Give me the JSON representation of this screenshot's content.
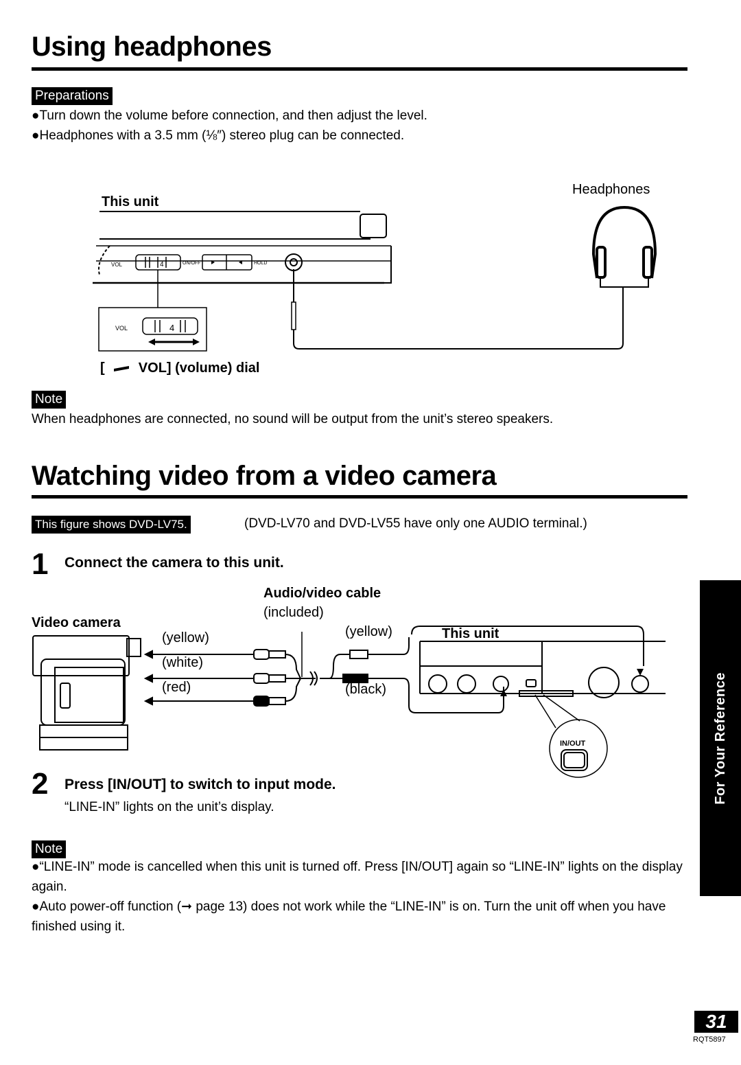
{
  "section1": {
    "title": "Using headphones",
    "preparations_label": "Preparations",
    "bullets": [
      "●Turn down the volume before connection, and then adjust the level.",
      "●Headphones with a 3.5 mm (⅛″) stereo plug can be connected."
    ],
    "figure": {
      "this_unit_label": "This unit",
      "headphones_label": "Headphones",
      "vol_label": "VOL",
      "dial_value": "4",
      "on_off_label": "ON/OFF",
      "hold_label": "HOLD",
      "dial_caption_prefix": "[",
      "dial_caption": "VOL] (volume) dial"
    },
    "note_label": "Note",
    "note_text": "When headphones are connected, no sound will be output from the unit’s stereo speakers."
  },
  "section2": {
    "title": "Watching video from a video camera",
    "figure_tag": "This figure shows DVD-LV75.",
    "figure_tag_note": "(DVD-LV70 and DVD-LV55 have only one AUDIO terminal.)",
    "steps": [
      {
        "number": "1",
        "title": "Connect the camera to this unit."
      },
      {
        "number": "2",
        "title": "Press [IN/OUT] to switch to input mode.",
        "detail": "“LINE-IN” lights on the unit’s display."
      }
    ],
    "figure": {
      "cable_label": "Audio/video cable",
      "cable_sub": "(included)",
      "camera_label": "Video camera",
      "plug_left": [
        "(yellow)",
        "(white)",
        "(red)"
      ],
      "plug_right": [
        "(yellow)",
        "(black)"
      ],
      "this_unit_label": "This unit",
      "in_out_label": "IN/OUT"
    },
    "note_label": "Note",
    "note_bullets": [
      "●“LINE-IN” mode is cancelled when this unit is turned off. Press [IN/OUT] again so “LINE-IN” lights on the display again.",
      "●Auto power-off function (➞ page 13) does not work while the “LINE-IN” is on. Turn the unit off when you have finished using it."
    ]
  },
  "sidebar": {
    "label": "For Your Reference"
  },
  "footer": {
    "page_number": "31",
    "doc_code": "RQT5897"
  }
}
